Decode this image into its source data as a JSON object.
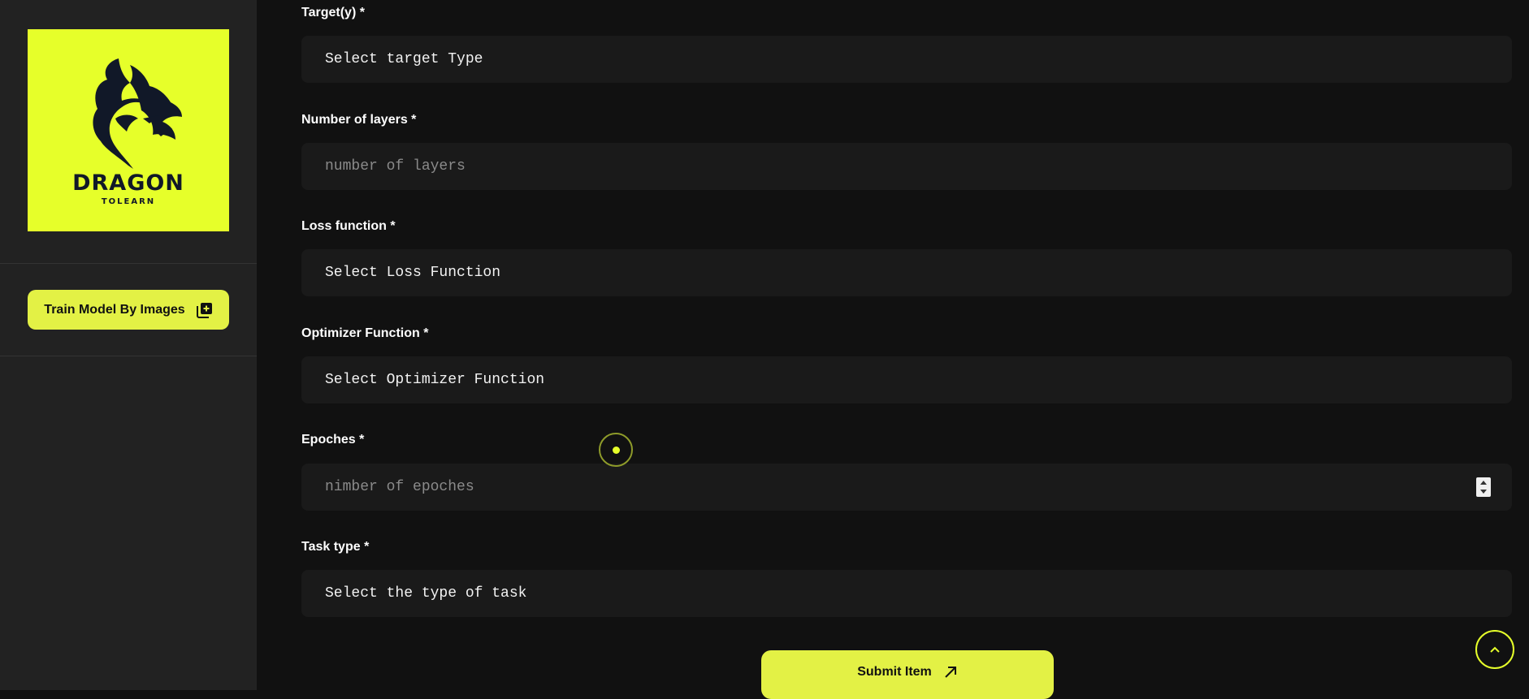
{
  "sidebar": {
    "logo": {
      "word": "DRAGON",
      "tagline": "TOLEARN",
      "icon": "dragon-head-logo",
      "background": "#e6ff2a"
    },
    "train_button": {
      "label": "Train Model By Images",
      "icon": "add-images-icon"
    }
  },
  "form": {
    "fields": [
      {
        "label": "Target(y) *",
        "kind": "select",
        "value": "Select target Type"
      },
      {
        "label": "Number of layers *",
        "kind": "input",
        "placeholder": "number of layers"
      },
      {
        "label": "Loss function *",
        "kind": "select",
        "value": "Select Loss Function"
      },
      {
        "label": "Optimizer Function *",
        "kind": "select",
        "value": "Select Optimizer Function"
      },
      {
        "label": "Epoches *",
        "kind": "number",
        "placeholder": "nimber of epoches"
      },
      {
        "label": "Task type *",
        "kind": "select",
        "value": "Select the type of task"
      }
    ],
    "submit": {
      "label": "Submit Item",
      "icon": "arrow-up-right-icon"
    }
  },
  "scroll_top": {
    "icon": "chevron-up-icon"
  },
  "colors": {
    "accent": "#e3f145",
    "page_bg": "#111111",
    "sidebar_bg": "#222222",
    "field_bg": "#1a1a1a"
  }
}
